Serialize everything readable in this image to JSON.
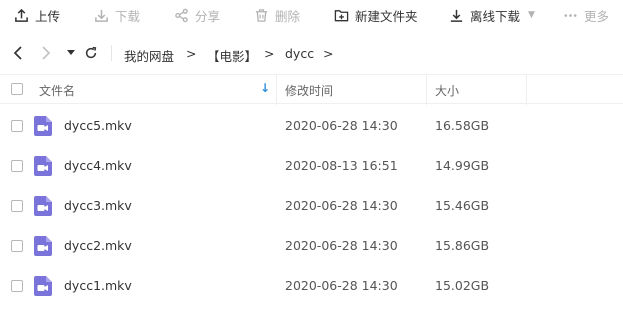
{
  "toolbar": {
    "upload": "上传",
    "download": "下载",
    "share": "分享",
    "delete": "删除",
    "new_folder": "新建文件夹",
    "offline_download": "离线下载",
    "more": "更多"
  },
  "breadcrumb": {
    "items": [
      "我的网盘",
      "【电影】",
      "dycc"
    ],
    "separator": ">"
  },
  "table": {
    "headers": {
      "name": "文件名",
      "modified": "修改时间",
      "size": "大小"
    },
    "sort_indicator": "↓",
    "rows": [
      {
        "name": "dycc5.mkv",
        "modified": "2020-06-28 14:30",
        "size": "16.58GB"
      },
      {
        "name": "dycc4.mkv",
        "modified": "2020-08-13 16:51",
        "size": "14.99GB"
      },
      {
        "name": "dycc3.mkv",
        "modified": "2020-06-28 14:30",
        "size": "15.46GB"
      },
      {
        "name": "dycc2.mkv",
        "modified": "2020-06-28 14:30",
        "size": "15.86GB"
      },
      {
        "name": "dycc1.mkv",
        "modified": "2020-06-28 14:30",
        "size": "15.02GB"
      }
    ]
  },
  "colors": {
    "accent": "#2f8fdc",
    "video_icon": "#7a73d9",
    "disabled_text": "#b3b3b3"
  }
}
